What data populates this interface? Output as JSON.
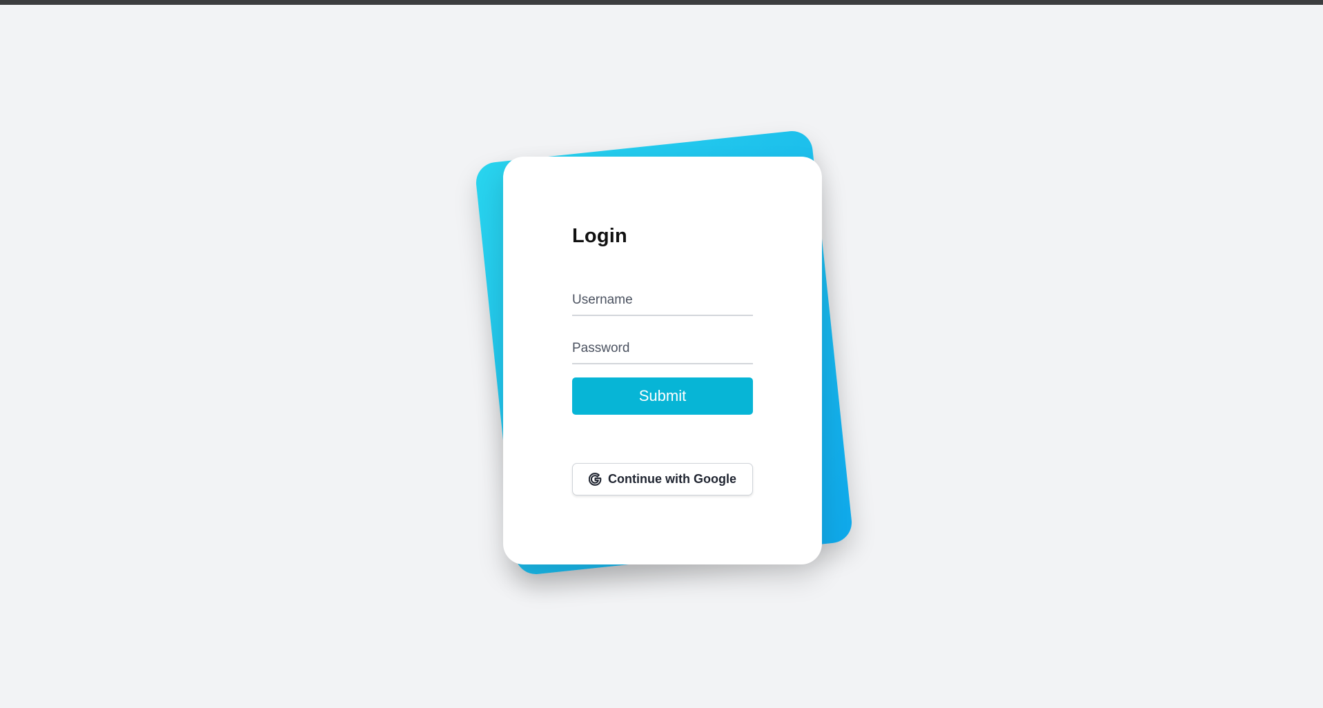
{
  "login": {
    "title": "Login",
    "username_placeholder": "Username",
    "password_placeholder": "Password",
    "submit_label": "Submit",
    "google_label": "Continue with Google"
  },
  "icons": {
    "google": "google-icon"
  },
  "colors": {
    "background": "#f2f3f5",
    "accent_gradient_start": "#29d4ee",
    "accent_gradient_end": "#0fa8ea",
    "submit_button": "#07b5d6",
    "card": "#ffffff"
  }
}
